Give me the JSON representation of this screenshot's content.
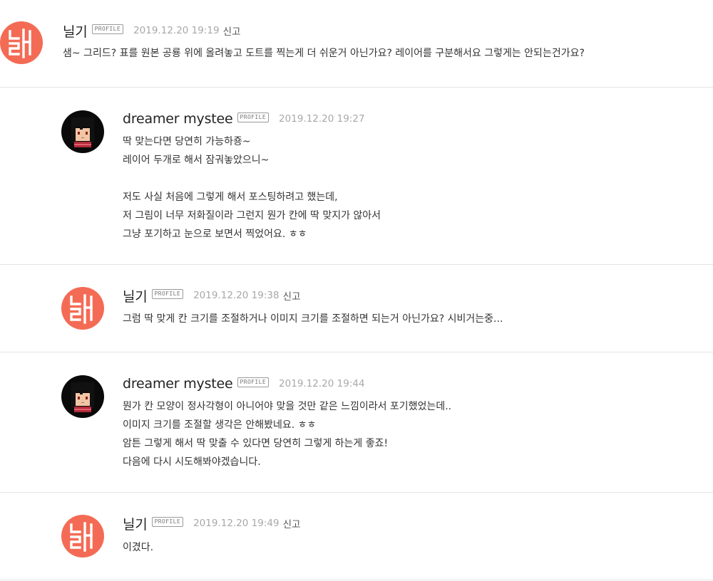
{
  "colors": {
    "nilgi_avatar_bg": "#f46b55",
    "text_main": "#333333",
    "text_date": "#a8a8a8",
    "divider": "#e4e4e4"
  },
  "comments": [
    {
      "author": "닐기",
      "badge": "PROFILE",
      "date": "2019.12.20 19:19",
      "report": "신고",
      "avatar_icon": "nilgi-logo-avatar",
      "lines": [
        "샘~ 그리드? 표를 원본 공룡 위에 올려놓고 도트를 찍는게 더 쉬운거 아닌가요? 레이어를 구분해서요 그렇게는 안되는건가요?"
      ]
    },
    {
      "author": "dreamer mystee",
      "badge": "PROFILE",
      "date": "2019.12.20 19:27",
      "avatar_icon": "pixel-character-avatar",
      "lines": [
        "딱 맞는다면 당연히 가능하죵~",
        "레이어 두개로 해서 잠궈놓았으니~",
        "",
        "저도 사실 처음에 그렇게 해서 포스팅하려고 했는데,",
        "저 그림이 너무 저화질이라 그런지 뭔가 칸에 딱 맞지가 않아서",
        "그냥 포기하고 눈으로 보면서 찍었어요. ㅎㅎ"
      ]
    },
    {
      "author": "닐기",
      "badge": "PROFILE",
      "date": "2019.12.20 19:38",
      "report": "신고",
      "avatar_icon": "nilgi-logo-avatar",
      "lines": [
        "그럼 딱 맞게 칸 크기를 조절하거나 이미지 크기를 조절하면 되는거 아닌가요? 시비거는중..."
      ]
    },
    {
      "author": "dreamer mystee",
      "badge": "PROFILE",
      "date": "2019.12.20 19:44",
      "avatar_icon": "pixel-character-avatar",
      "lines": [
        "뭔가 칸 모양이 정사각형이 아니어야 맞을 것만 같은 느낌이라서 포기했었는데..",
        "이미지 크기를 조절할 생각은 안해봤네요. ㅎㅎ",
        "암튼 그렇게 해서 딱 맞출 수 있다면 당연히 그렇게 하는게 좋죠!",
        "다음에 다시 시도해봐야겠습니다."
      ]
    },
    {
      "author": "닐기",
      "badge": "PROFILE",
      "date": "2019.12.20 19:49",
      "report": "신고",
      "avatar_icon": "nilgi-logo-avatar",
      "lines": [
        "이겼다."
      ]
    }
  ]
}
